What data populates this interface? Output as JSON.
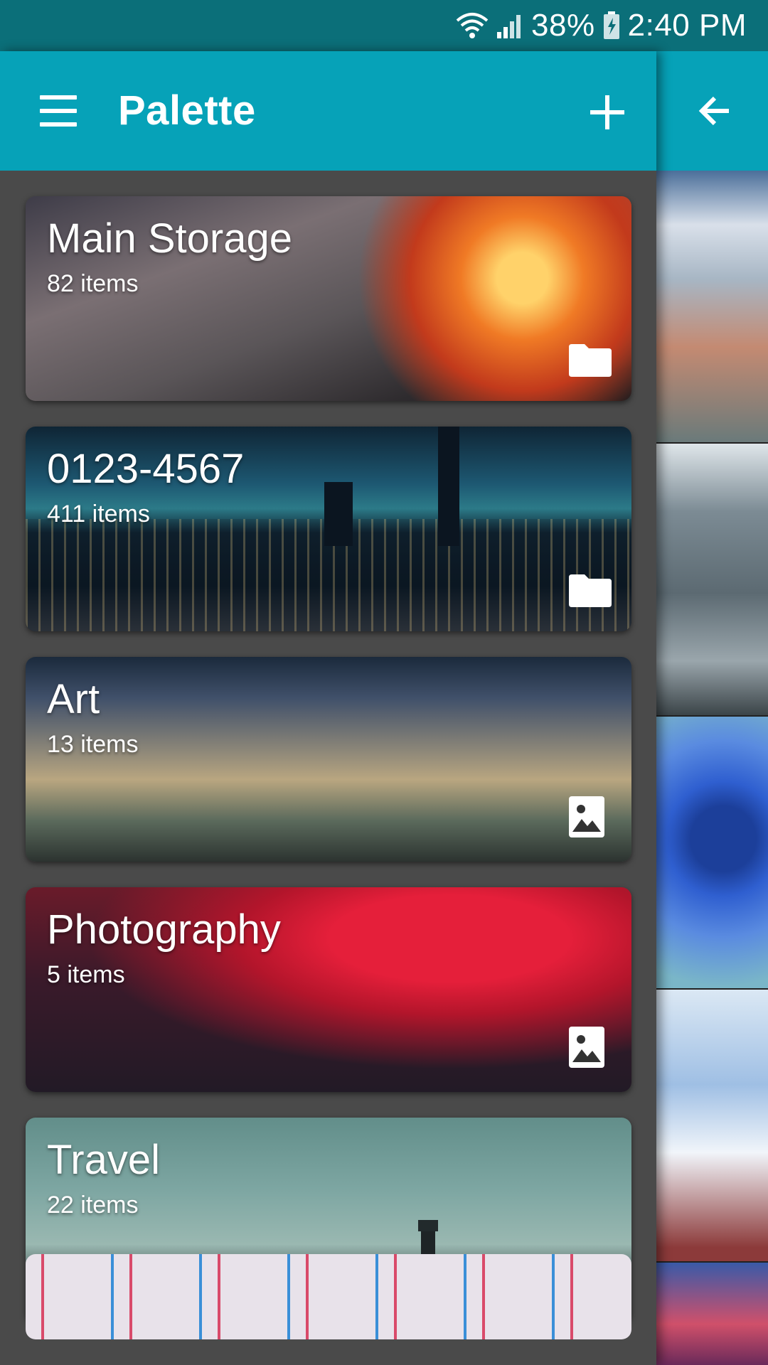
{
  "status_bar": {
    "battery": "38%",
    "time": "2:40 PM",
    "icons": [
      "wifi-icon",
      "signal-icon",
      "battery-charging-icon"
    ]
  },
  "app_bar": {
    "title": "Palette",
    "menu_icon": "hamburger-menu-icon",
    "add_icon": "plus-icon",
    "color": "#06a2b8"
  },
  "albums": [
    {
      "title": "Main Storage",
      "count": "82 items",
      "badge": "folder-icon"
    },
    {
      "title": "0123-4567",
      "count": "411 items",
      "badge": "folder-icon"
    },
    {
      "title": "Art",
      "count": "13 items",
      "badge": "image-icon"
    },
    {
      "title": "Photography",
      "count": "5 items",
      "badge": "image-icon"
    },
    {
      "title": "Travel",
      "count": "22 items",
      "badge": "image-icon"
    }
  ],
  "peek_panel": {
    "back_icon": "arrow-back-icon"
  },
  "colors": {
    "status_bar": "#0b6f79",
    "background": "#4a4a4a"
  }
}
